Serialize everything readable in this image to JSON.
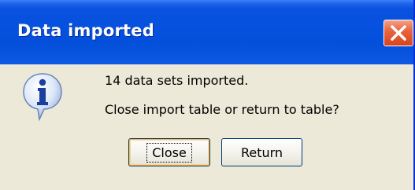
{
  "dialog": {
    "title": "Data imported",
    "message_line1": "14 data sets imported.",
    "message_line2": "Close import table or return to table?",
    "icon": "information-icon",
    "buttons": {
      "close_label": "Close",
      "return_label": "Return"
    }
  },
  "colors": {
    "titlebar": "#0551dd",
    "body": "#ece9d8",
    "close_button": "#d8431e"
  }
}
